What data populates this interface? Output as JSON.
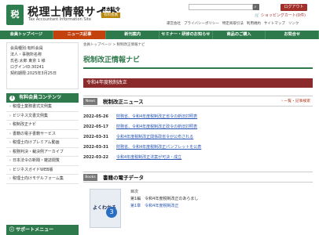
{
  "header": {
    "logo_glyph": "税",
    "site_title": "税理士情報サイト",
    "site_subtitle": "Tax Accountant Information Site",
    "publisher": "日本法令",
    "member_badge": "有料会員",
    "login_button": "ログアウト",
    "cart_label": "ショッピングカート(0件)",
    "util_links": [
      "運営会社",
      "プライバシーポリシー",
      "特定商取引法",
      "利用規約",
      "サイトマップ",
      "リンク"
    ]
  },
  "nav": {
    "items": [
      {
        "label": "会員トップページ",
        "active": false
      },
      {
        "label": "ニュース記事",
        "active": true
      },
      {
        "label": "新刊案内",
        "active": false
      },
      {
        "label": "セミナー・研修のお知らせ",
        "active": false
      },
      {
        "label": "商品のご購入",
        "active": false
      },
      {
        "label": "お問合せ",
        "active": false
      }
    ]
  },
  "sidebar": {
    "member_lines": [
      "会員種別:有料会員",
      "法人・事務所名称",
      "氏名:太郎 東京 1 様",
      "ログインID:30241",
      "契約期限:2025年3月25日"
    ],
    "paid_heading": "有料会員コンテンツ",
    "paid_items": [
      "税理士業務書式文例集",
      "ビジネス文書文例集",
      "税制改正ナビ",
      "書籍の電子書籍サービス",
      "税理士向けプレミアム動画",
      "税務判決・裁決例アーカイブ",
      "日本法令の新聞・雑誌閲覧",
      "ビジネスガイドWEB版",
      "税理士向けモデルフォーム集"
    ],
    "support_heading": "サポートメニュー"
  },
  "main": {
    "breadcrumb": "会員トップページ > 税制改正情報ナビ",
    "page_title": "税制改正情報ナビ",
    "year_bar": "令和4年度税制改正",
    "news_tag": "News",
    "news_title": "税制改正ニュース",
    "news_link": "一覧・記事検索",
    "news": [
      {
        "date": "2022-05-26",
        "title": "財務省、令和4年度税制改正省令の新旧対照表"
      },
      {
        "date": "2022-05-17",
        "title": "財務省、令和4年度税制改正政令の新旧対照表"
      },
      {
        "date": "2022-03-31",
        "title": "令和4年度税制改正関係政省令が公布される"
      },
      {
        "date": "2022-03-31",
        "title": "財務省、令和4年度税制改正パンフレットを公表"
      },
      {
        "date": "2022-03-22",
        "title": "令和4年度税制改正法案が可決・成立"
      }
    ],
    "books_tag": "Books",
    "books_title": "書籍の電子データ",
    "book": {
      "cover_label": "よくわかる",
      "cover_number": "3",
      "contents_label": "目次",
      "chapter": "第1編　令和4年度税制改正のあらまし",
      "link": "第1章　令和4年度税制改正"
    }
  }
}
